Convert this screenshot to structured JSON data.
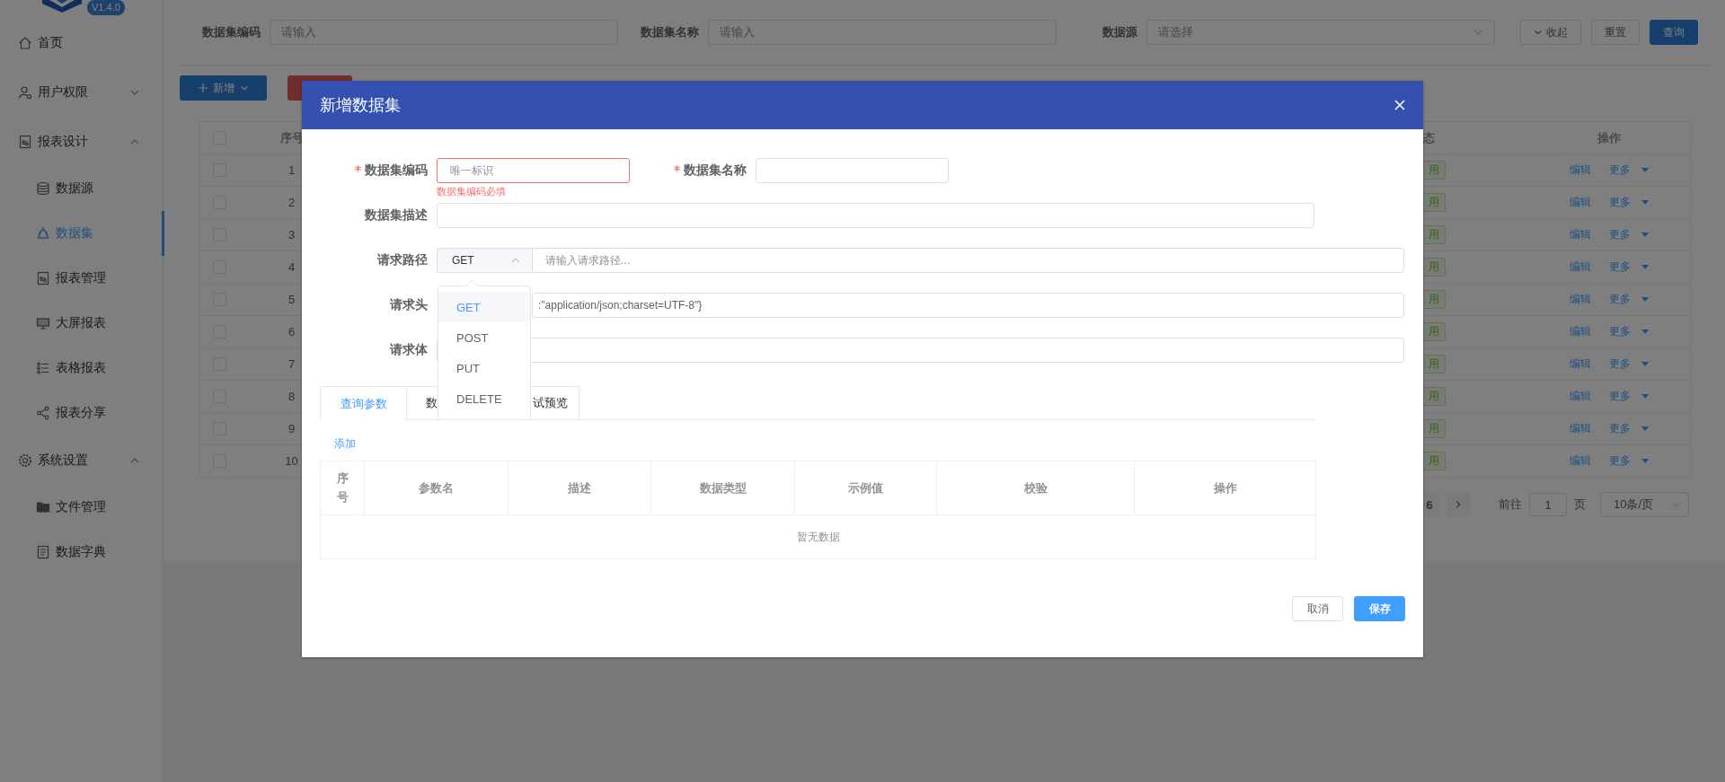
{
  "sidebar": {
    "version": "V1.4.0",
    "items": [
      {
        "label": "首页",
        "selected": false
      },
      {
        "label": "用户权限",
        "selected": false,
        "expanded": false
      },
      {
        "label": "报表设计",
        "selected": false,
        "expanded": true,
        "children": [
          {
            "label": "数据源",
            "selected": false
          },
          {
            "label": "数据集",
            "selected": true
          },
          {
            "label": "报表管理",
            "selected": false
          },
          {
            "label": "大屏报表",
            "selected": false
          },
          {
            "label": "表格报表",
            "selected": false
          },
          {
            "label": "报表分享",
            "selected": false
          }
        ]
      },
      {
        "label": "系统设置",
        "selected": false,
        "expanded": true,
        "children": [
          {
            "label": "文件管理",
            "selected": false
          },
          {
            "label": "数据字典",
            "selected": false
          }
        ]
      }
    ]
  },
  "search": {
    "fields": [
      {
        "label": "数据集编码",
        "placeholder": "请输入",
        "kind": "input"
      },
      {
        "label": "数据集名称",
        "placeholder": "请输入",
        "kind": "input"
      },
      {
        "label": "数据源",
        "placeholder": "请选择",
        "kind": "select"
      }
    ],
    "buttons": [
      {
        "label": "收起",
        "kind": "collapse"
      },
      {
        "label": "重置",
        "kind": "plain"
      },
      {
        "label": "查询",
        "kind": "primary"
      }
    ]
  },
  "toolbar": [
    {
      "label": "新增",
      "kind": "add"
    },
    {
      "kind": "danger"
    }
  ],
  "table": {
    "all_checked": false,
    "index_header": "序号",
    "status_header": "态",
    "actions_header": "操作",
    "rows": [
      {
        "checked": false,
        "index": "1",
        "status": "用",
        "actions": [
          "编辑",
          "更多"
        ]
      },
      {
        "checked": false,
        "index": "2",
        "status": "用",
        "actions": [
          "编辑",
          "更多"
        ]
      },
      {
        "checked": false,
        "index": "3",
        "status": "用",
        "actions": [
          "编辑",
          "更多"
        ]
      },
      {
        "checked": false,
        "index": "4",
        "status": "用",
        "actions": [
          "编辑",
          "更多"
        ]
      },
      {
        "checked": false,
        "index": "5",
        "status": "用",
        "actions": [
          "编辑",
          "更多"
        ]
      },
      {
        "checked": false,
        "index": "6",
        "status": "用",
        "actions": [
          "编辑",
          "更多"
        ]
      },
      {
        "checked": false,
        "index": "7",
        "status": "用",
        "actions": [
          "编辑",
          "更多"
        ]
      },
      {
        "checked": false,
        "index": "8",
        "status": "用",
        "actions": [
          "编辑",
          "更多"
        ]
      },
      {
        "checked": false,
        "index": "9",
        "status": "用",
        "actions": [
          "编辑",
          "更多"
        ]
      },
      {
        "checked": false,
        "index": "10",
        "status": "用",
        "actions": [
          "编辑",
          "更多"
        ]
      }
    ]
  },
  "pagination": {
    "pages": [
      {
        "label": "6",
        "selected": false
      }
    ],
    "jump_label": "前往",
    "page": "1",
    "page_suffix": "页",
    "page_size": "10条/页"
  },
  "dialog": {
    "title": "新增数据集",
    "code": {
      "label": "数据集编码",
      "required": true,
      "placeholder": "唯一标识",
      "error": "数据集编码必填"
    },
    "name": {
      "label": "数据集名称",
      "required": true
    },
    "description": {
      "label": "数据集描述"
    },
    "path": {
      "label": "请求路径",
      "method": "GET",
      "placeholder": "请输入请求路径...",
      "menu_open": true,
      "methods": [
        {
          "label": "GET",
          "selected": true
        },
        {
          "label": "POST",
          "selected": false
        },
        {
          "label": "PUT",
          "selected": false
        },
        {
          "label": "DELETE",
          "selected": false
        }
      ]
    },
    "headers": {
      "label": "请求头",
      "value": ":\"application/json;charset=UTF-8\"}"
    },
    "body": {
      "label": "请求体"
    },
    "tabs": [
      {
        "label": "查询参数",
        "selected": true
      },
      {
        "label": "数",
        "selected": false
      },
      {
        "label": "试预览",
        "selected": false
      }
    ],
    "add_link": "添加",
    "params": {
      "columns": [
        "序号",
        "参数名",
        "描述",
        "数据类型",
        "示例值",
        "校验",
        "操作"
      ],
      "empty_text": "暂无数据"
    },
    "buttons": [
      {
        "label": "取消",
        "kind": "plain"
      },
      {
        "label": "保存",
        "kind": "primary"
      }
    ]
  }
}
